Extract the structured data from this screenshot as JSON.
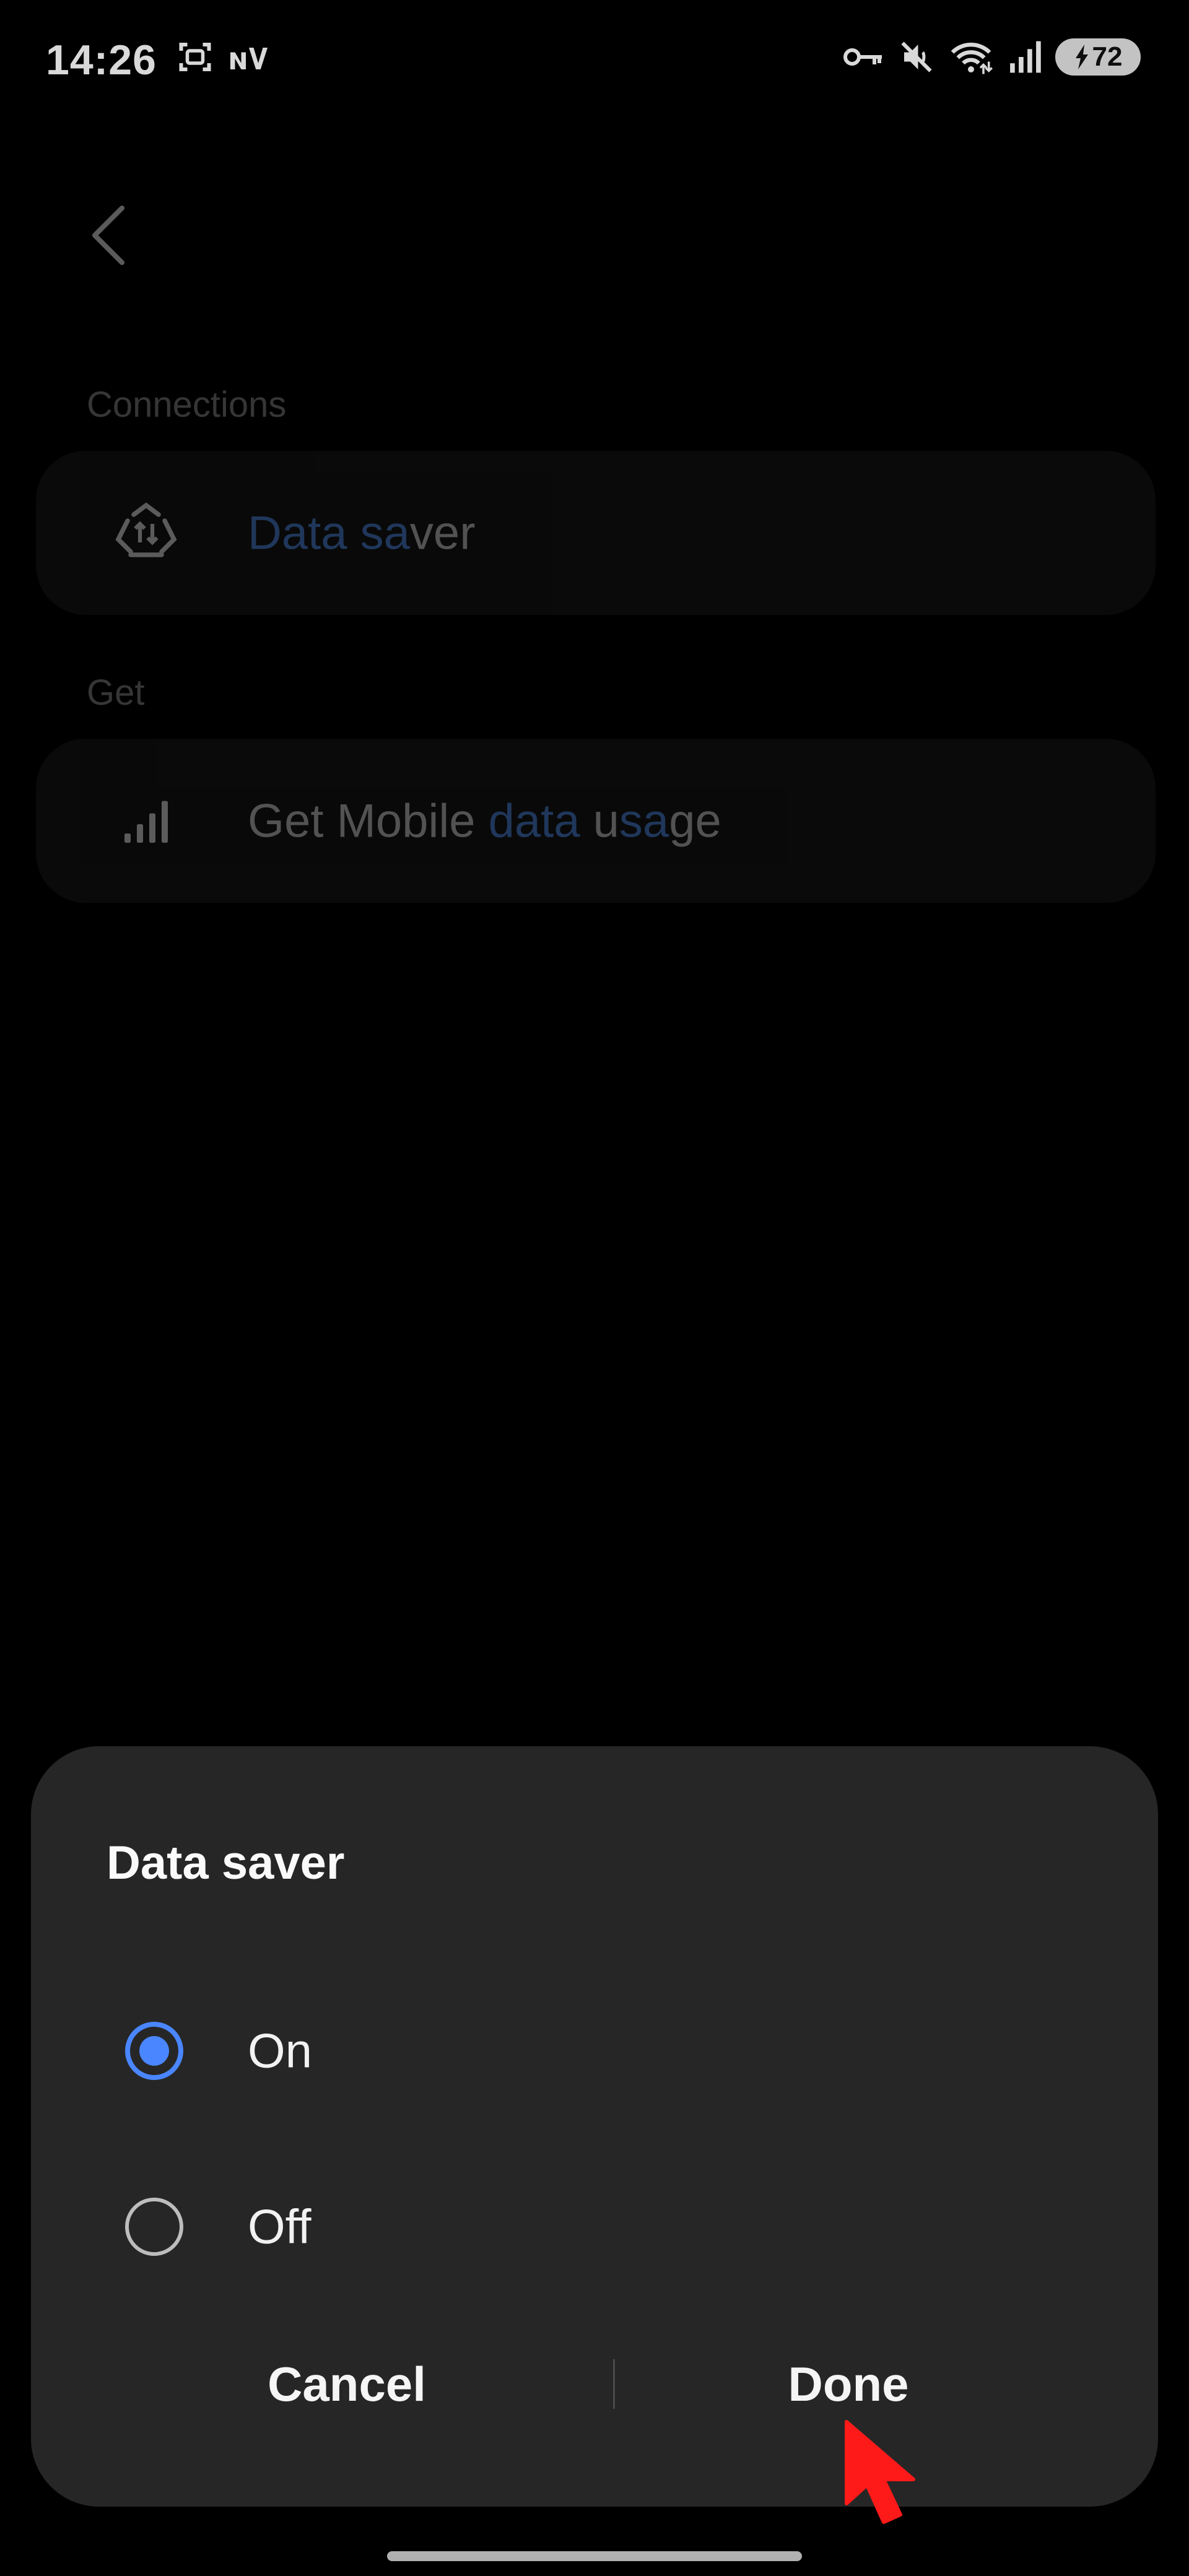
{
  "status_bar": {
    "time": "14:26",
    "left_icons": [
      "screenshot-icon",
      "network-nv-icon"
    ],
    "right_icons": [
      "key-icon",
      "mute-icon",
      "wifi-icon",
      "signal-icon"
    ],
    "battery_level": "72",
    "battery_charging": true
  },
  "page": {
    "back_icon": "chevron-left-icon",
    "sections": [
      {
        "label": "Connections",
        "result": {
          "icon": "data-saver-icon",
          "title_parts": [
            {
              "text": "Data sa",
              "highlight": true
            },
            {
              "text": "ver",
              "highlight": false
            }
          ]
        }
      },
      {
        "label": "Get",
        "result": {
          "icon": "signal-bars-icon",
          "title_parts": [
            {
              "text": "Get Mobile ",
              "highlight": false
            },
            {
              "text": "data",
              "highlight": true
            },
            {
              "text": " u",
              "highlight": false
            },
            {
              "text": "sa",
              "highlight": true
            },
            {
              "text": "ge",
              "highlight": false
            }
          ]
        }
      }
    ]
  },
  "dialog": {
    "title": "Data saver",
    "options": [
      {
        "label": "On",
        "selected": true
      },
      {
        "label": "Off",
        "selected": false
      }
    ],
    "cancel_label": "Cancel",
    "done_label": "Done"
  },
  "colors": {
    "accent": "#4a86ff",
    "highlight": "#5b9bff",
    "dialog_bg": "#262626",
    "cursor": "#ff1a1a"
  }
}
